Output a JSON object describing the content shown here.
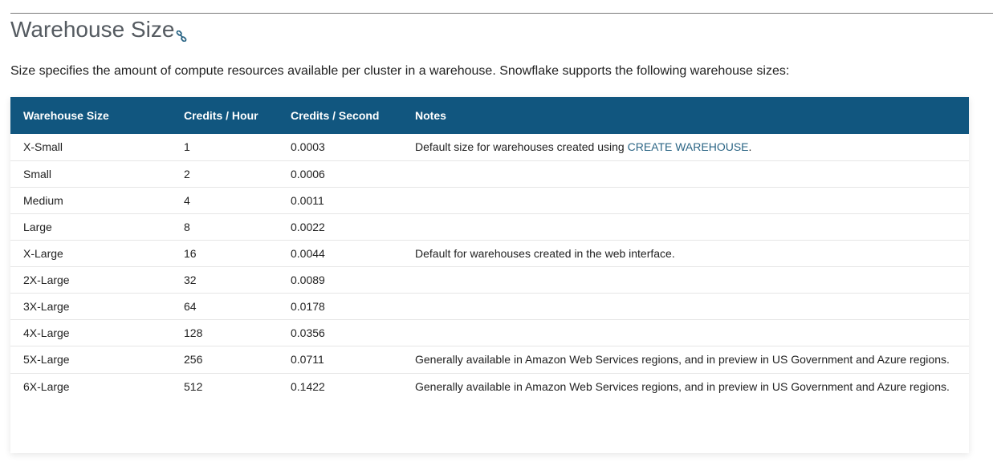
{
  "section": {
    "title": "Warehouse Size",
    "intro": "Size specifies the amount of compute resources available per cluster in a warehouse. Snowflake supports the following warehouse sizes:"
  },
  "table": {
    "headers": [
      "Warehouse Size",
      "Credits / Hour",
      "Credits / Second",
      "Notes"
    ],
    "rows": [
      {
        "size": "X-Small",
        "credits_hour": "1",
        "credits_second": "0.0003",
        "note_prefix": "Default size for warehouses created using ",
        "note_link": "CREATE WAREHOUSE",
        "note_suffix": "."
      },
      {
        "size": "Small",
        "credits_hour": "2",
        "credits_second": "0.0006",
        "note": ""
      },
      {
        "size": "Medium",
        "credits_hour": "4",
        "credits_second": "0.0011",
        "note": ""
      },
      {
        "size": "Large",
        "credits_hour": "8",
        "credits_second": "0.0022",
        "note": ""
      },
      {
        "size": "X-Large",
        "credits_hour": "16",
        "credits_second": "0.0044",
        "note": "Default for warehouses created in the web interface."
      },
      {
        "size": "2X-Large",
        "credits_hour": "32",
        "credits_second": "0.0089",
        "note": ""
      },
      {
        "size": "3X-Large",
        "credits_hour": "64",
        "credits_second": "0.0178",
        "note": ""
      },
      {
        "size": "4X-Large",
        "credits_hour": "128",
        "credits_second": "0.0356",
        "note": ""
      },
      {
        "size": "5X-Large",
        "credits_hour": "256",
        "credits_second": "0.0711",
        "note": "Generally available in Amazon Web Services regions, and in preview in US Government and Azure regions."
      },
      {
        "size": "6X-Large",
        "credits_hour": "512",
        "credits_second": "0.1422",
        "note": "Generally available in Amazon Web Services regions, and in preview in US Government and Azure regions."
      }
    ]
  },
  "colors": {
    "header_bg": "#11567f",
    "heading_text": "#555b61",
    "link": "#2b6585"
  },
  "icons": {
    "anchor": "link-icon"
  }
}
